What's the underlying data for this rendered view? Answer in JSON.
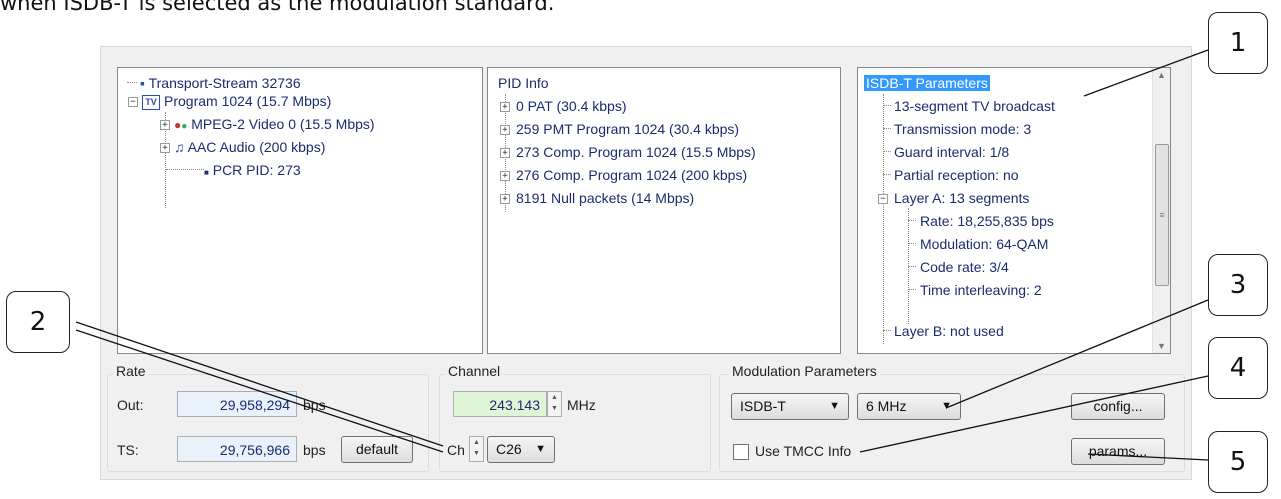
{
  "caption": "when ISDB-T is selected as the modulation standard.",
  "transport_tree": {
    "root": "Transport-Stream  32736",
    "program": "Program 1024 (15.7 Mbps)",
    "program_icon": "TV",
    "items": [
      "MPEG-2 Video 0 (15.5 Mbps)",
      "AAC Audio (200 kbps)",
      "PCR PID: 273"
    ]
  },
  "pid_info": {
    "title": "PID Info",
    "items": [
      "0 PAT  (30.4 kbps)",
      "259 PMT Program 1024  (30.4 kbps)",
      "273 Comp. Program 1024  (15.5 Mbps)",
      "276 Comp. Program 1024  (200 kbps)",
      "8191 Null packets  (14 Mbps)"
    ]
  },
  "isdbt": {
    "title": "ISDB-T Parameters",
    "items": [
      "13-segment TV broadcast",
      "Transmission mode: 3",
      "Guard interval: 1/8",
      "Partial reception: no",
      "Layer A: 13 segments"
    ],
    "layer_items": [
      "Rate: 18,255,835 bps",
      "Modulation: 64-QAM",
      "Code rate: 3/4",
      "Time interleaving: 2"
    ],
    "last": "Layer B: not used"
  },
  "rate": {
    "label": "Rate",
    "out_label": "Out:",
    "out_value": "29,958,294",
    "out_unit": "bps",
    "ts_label": "TS:",
    "ts_value": "29,756,966",
    "ts_unit": "bps",
    "default_button": "default"
  },
  "channel": {
    "label": "Channel",
    "freq_value": "243.143",
    "freq_unit": "MHz",
    "ch_label": "Ch",
    "ch_value": "C26"
  },
  "modulation": {
    "label": "Modulation Parameters",
    "standard": "ISDB-T",
    "bandwidth": "6 MHz",
    "tmcc_label": "Use TMCC Info",
    "tmcc_checked": false,
    "config_button": "config...",
    "params_button": "params..."
  },
  "callouts": [
    "1",
    "2",
    "3",
    "4",
    "5"
  ]
}
